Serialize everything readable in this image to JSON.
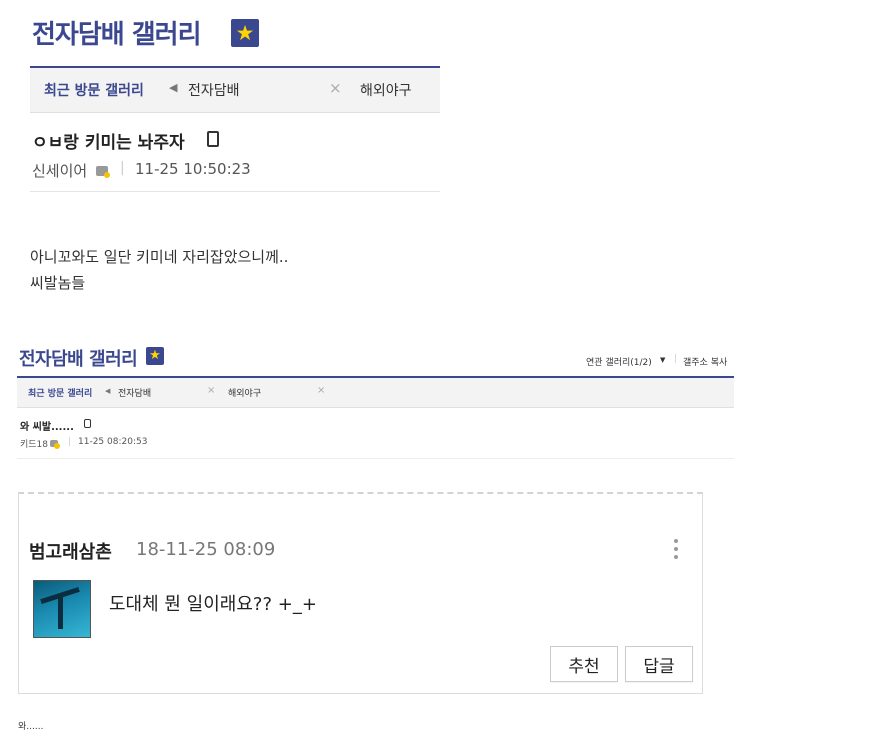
{
  "top": {
    "gallery_title": "전자담배 갤러리",
    "star_glyph": "★",
    "recent_label": "최근 방문 갤러리",
    "arrow_glyph": "◀",
    "tabs": [
      "전자담배",
      "해외야구"
    ],
    "close_glyph": "×",
    "post_title": "ㅇㅂ랑 키미는 놔주자",
    "author": "신세이어",
    "separator": "|",
    "datetime": "11-25 10:50:23",
    "body_lines": [
      "아니꼬와도 일단 키미네 자리잡았으니께..",
      "씨발놈들"
    ]
  },
  "second": {
    "gallery_title": "전자담배 갤러리",
    "star_glyph": "★",
    "related_label": "연관 갤러리(1/2)",
    "caret_glyph": "▼",
    "separator": "|",
    "copy_address_label": "갤주소 복사",
    "recent_label": "최근 방문 갤러리",
    "arrow_glyph": "◀",
    "tabs": [
      "전자담배",
      "해외야구"
    ],
    "close_glyph": "×",
    "post_title": "와 씨발......",
    "author": "키드18",
    "datetime": "11-25 08:20:53"
  },
  "comment": {
    "name": "범고래삼촌",
    "datetime": "18-11-25 08:09",
    "more_glyph": "⋮",
    "text": "도대체 뭔 일이래요?? +_+",
    "recommend_label": "추천",
    "reply_label": "답글"
  },
  "footer_text": "와......",
  "colors": {
    "accent": "#3b4890",
    "star": "#ffd500"
  }
}
